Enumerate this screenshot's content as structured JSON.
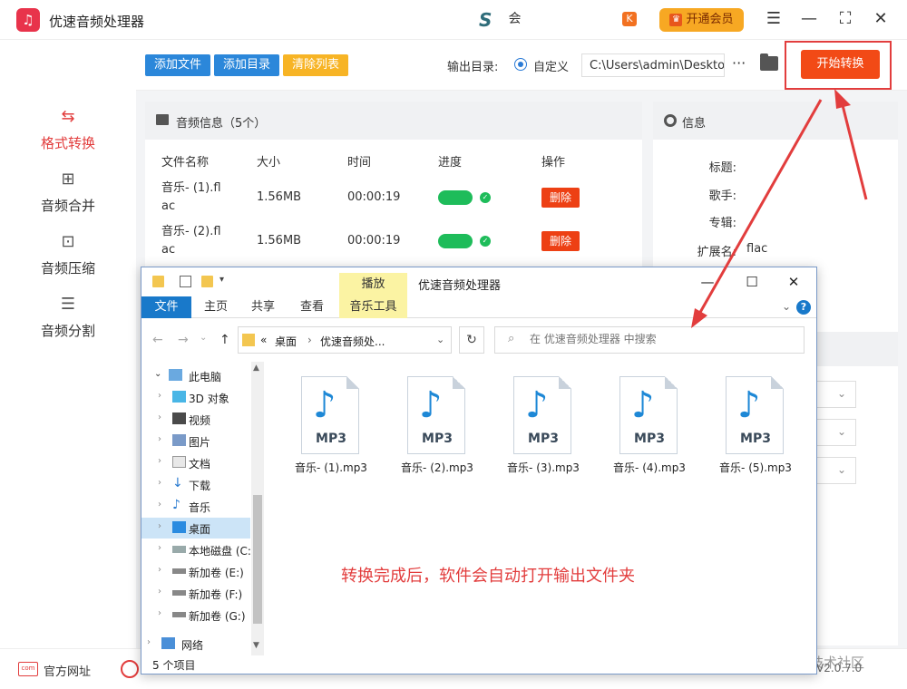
{
  "app": {
    "title": "优速音频处理器",
    "logo_icon": "headphones-icon",
    "user_name": "会",
    "vip_label": "开通会员",
    "vip_badge": "K"
  },
  "sidebar": {
    "items": [
      {
        "label": "格式转换",
        "icon": "convert-icon",
        "active": true
      },
      {
        "label": "音频合并",
        "icon": "merge-icon",
        "active": false
      },
      {
        "label": "音频压缩",
        "icon": "compress-icon",
        "active": false
      },
      {
        "label": "音频分割",
        "icon": "split-icon",
        "active": false
      }
    ]
  },
  "toolbar": {
    "add_file": "添加文件",
    "add_dir": "添加目录",
    "clear_list": "清除列表",
    "output_label": "输出目录:",
    "output_option": "自定义",
    "output_path": "C:\\Users\\admin\\Desktop",
    "more": "···",
    "start": "开始转换",
    "colors": {
      "blue": "#2b87da",
      "yellow": "#f7b425",
      "start": "#f24a16"
    }
  },
  "audio_panel": {
    "title": "音频信息（5个）",
    "columns": [
      "文件名称",
      "大小",
      "时间",
      "进度",
      "操作"
    ],
    "rows": [
      {
        "name_line1": "音乐- (1).fl",
        "name_line2": "ac",
        "size": "1.56MB",
        "time": "00:00:19",
        "progress": 1.0,
        "action": "删除"
      },
      {
        "name_line1": "音乐- (2).fl",
        "name_line2": "ac",
        "size": "1.56MB",
        "time": "00:00:19",
        "progress": 1.0,
        "action": "删除"
      }
    ]
  },
  "info_panel": {
    "title": "信息",
    "fields": [
      {
        "label": "标题:",
        "value": ""
      },
      {
        "label": "歌手:",
        "value": ""
      },
      {
        "label": "专辑:",
        "value": ""
      },
      {
        "label": "扩展名:",
        "value": "flac"
      }
    ]
  },
  "bottom": {
    "website": "官方网址",
    "website_icon_text": "com",
    "watermark": "@稀土掘金技术社区",
    "version": "V2.0.7.0"
  },
  "explorer": {
    "title": "优速音频处理器",
    "context_tab": "播放",
    "ribbon_tabs": [
      "文件",
      "主页",
      "共享",
      "查看",
      "音乐工具"
    ],
    "address": {
      "prefix": "«",
      "crumb1": "桌面",
      "crumb2": "优速音频处..."
    },
    "search_placeholder": "在 优速音频处理器 中搜索",
    "nav": [
      {
        "label": "此电脑",
        "icon": "computer-icon",
        "selected": false
      },
      {
        "label": "3D 对象",
        "icon": "cube-icon",
        "selected": false
      },
      {
        "label": "视频",
        "icon": "video-icon",
        "selected": false
      },
      {
        "label": "图片",
        "icon": "picture-icon",
        "selected": false
      },
      {
        "label": "文档",
        "icon": "document-icon",
        "selected": false
      },
      {
        "label": "下载",
        "icon": "download-icon",
        "selected": false
      },
      {
        "label": "音乐",
        "icon": "music-icon",
        "selected": false
      },
      {
        "label": "桌面",
        "icon": "desktop-icon",
        "selected": true
      },
      {
        "label": "本地磁盘 (C:",
        "icon": "drive-icon",
        "selected": false
      },
      {
        "label": "新加卷 (E:)",
        "icon": "drive-icon",
        "selected": false
      },
      {
        "label": "新加卷 (F:)",
        "icon": "drive-icon",
        "selected": false
      },
      {
        "label": "新加卷 (G:)",
        "icon": "drive-icon",
        "selected": false
      },
      {
        "label": "网络",
        "icon": "network-icon",
        "selected": false
      }
    ],
    "files": [
      {
        "name": "音乐- (1).mp3",
        "ext": "MP3"
      },
      {
        "name": "音乐- (2).mp3",
        "ext": "MP3"
      },
      {
        "name": "音乐- (3).mp3",
        "ext": "MP3"
      },
      {
        "name": "音乐- (4).mp3",
        "ext": "MP3"
      },
      {
        "name": "音乐- (5).mp3",
        "ext": "MP3"
      }
    ],
    "annotation": "转换完成后，软件会自动打开输出文件夹",
    "status": "5 个项目"
  }
}
